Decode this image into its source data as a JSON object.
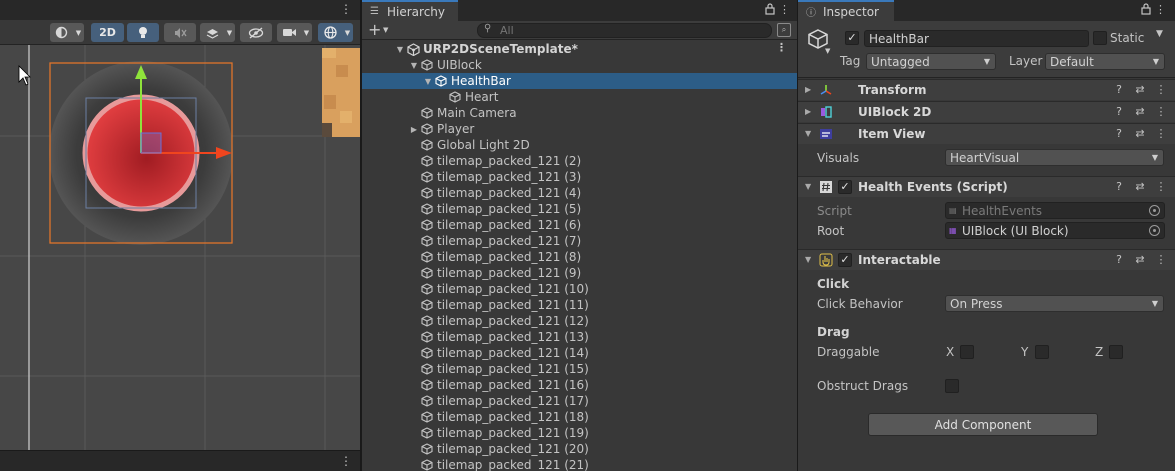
{
  "scene": {
    "toolbar": {
      "mode_2d": "2D"
    }
  },
  "hierarchy": {
    "tab_label": "Hierarchy",
    "search_placeholder": "All",
    "scene_root": "URP2DSceneTemplate*",
    "items": [
      {
        "label": "UIBlock",
        "depth": 1,
        "fold": "open"
      },
      {
        "label": "HealthBar",
        "depth": 2,
        "fold": "open",
        "selected": true
      },
      {
        "label": "Heart",
        "depth": 3,
        "fold": "none"
      },
      {
        "label": "Main Camera",
        "depth": 1,
        "fold": "none"
      },
      {
        "label": "Player",
        "depth": 1,
        "fold": "closed"
      },
      {
        "label": "Global Light 2D",
        "depth": 1,
        "fold": "none"
      },
      {
        "label": "tilemap_packed_121 (2)",
        "depth": 1,
        "fold": "none"
      },
      {
        "label": "tilemap_packed_121 (3)",
        "depth": 1,
        "fold": "none"
      },
      {
        "label": "tilemap_packed_121 (4)",
        "depth": 1,
        "fold": "none"
      },
      {
        "label": "tilemap_packed_121 (5)",
        "depth": 1,
        "fold": "none"
      },
      {
        "label": "tilemap_packed_121 (6)",
        "depth": 1,
        "fold": "none"
      },
      {
        "label": "tilemap_packed_121 (7)",
        "depth": 1,
        "fold": "none"
      },
      {
        "label": "tilemap_packed_121 (8)",
        "depth": 1,
        "fold": "none"
      },
      {
        "label": "tilemap_packed_121 (9)",
        "depth": 1,
        "fold": "none"
      },
      {
        "label": "tilemap_packed_121 (10)",
        "depth": 1,
        "fold": "none"
      },
      {
        "label": "tilemap_packed_121 (11)",
        "depth": 1,
        "fold": "none"
      },
      {
        "label": "tilemap_packed_121 (12)",
        "depth": 1,
        "fold": "none"
      },
      {
        "label": "tilemap_packed_121 (13)",
        "depth": 1,
        "fold": "none"
      },
      {
        "label": "tilemap_packed_121 (14)",
        "depth": 1,
        "fold": "none"
      },
      {
        "label": "tilemap_packed_121 (15)",
        "depth": 1,
        "fold": "none"
      },
      {
        "label": "tilemap_packed_121 (16)",
        "depth": 1,
        "fold": "none"
      },
      {
        "label": "tilemap_packed_121 (17)",
        "depth": 1,
        "fold": "none"
      },
      {
        "label": "tilemap_packed_121 (18)",
        "depth": 1,
        "fold": "none"
      },
      {
        "label": "tilemap_packed_121 (19)",
        "depth": 1,
        "fold": "none"
      },
      {
        "label": "tilemap_packed_121 (20)",
        "depth": 1,
        "fold": "none"
      },
      {
        "label": "tilemap_packed_121 (21)",
        "depth": 1,
        "fold": "none"
      }
    ]
  },
  "inspector": {
    "tab_label": "Inspector",
    "object_name": "HealthBar",
    "static_label": "Static",
    "tag_label": "Tag",
    "tag_value": "Untagged",
    "layer_label": "Layer",
    "layer_value": "Default",
    "components": {
      "transform": "Transform",
      "uiblock2d": "UIBlock 2D",
      "itemview": "Item View",
      "healthevents": "Health Events (Script)",
      "interactable": "Interactable"
    },
    "itemview": {
      "visuals_label": "Visuals",
      "visuals_value": "HeartVisual"
    },
    "healthevents": {
      "script_label": "Script",
      "script_value": "HealthEvents",
      "root_label": "Root",
      "root_value": "UIBlock (UI Block)"
    },
    "interactable": {
      "click_header": "Click",
      "click_behavior_label": "Click Behavior",
      "click_behavior_value": "On Press",
      "drag_header": "Drag",
      "draggable_label": "Draggable",
      "axis_x": "X",
      "axis_y": "Y",
      "axis_z": "Z",
      "obstruct_label": "Obstruct Drags"
    },
    "add_component": "Add Component"
  },
  "colors": {
    "selection": "#2c5d87",
    "panel": "#383838",
    "tab_accent": "#3a79bb",
    "heart_red": "#d9363a",
    "gizmo_y": "#8fe33b",
    "gizmo_x": "#f0451e"
  }
}
